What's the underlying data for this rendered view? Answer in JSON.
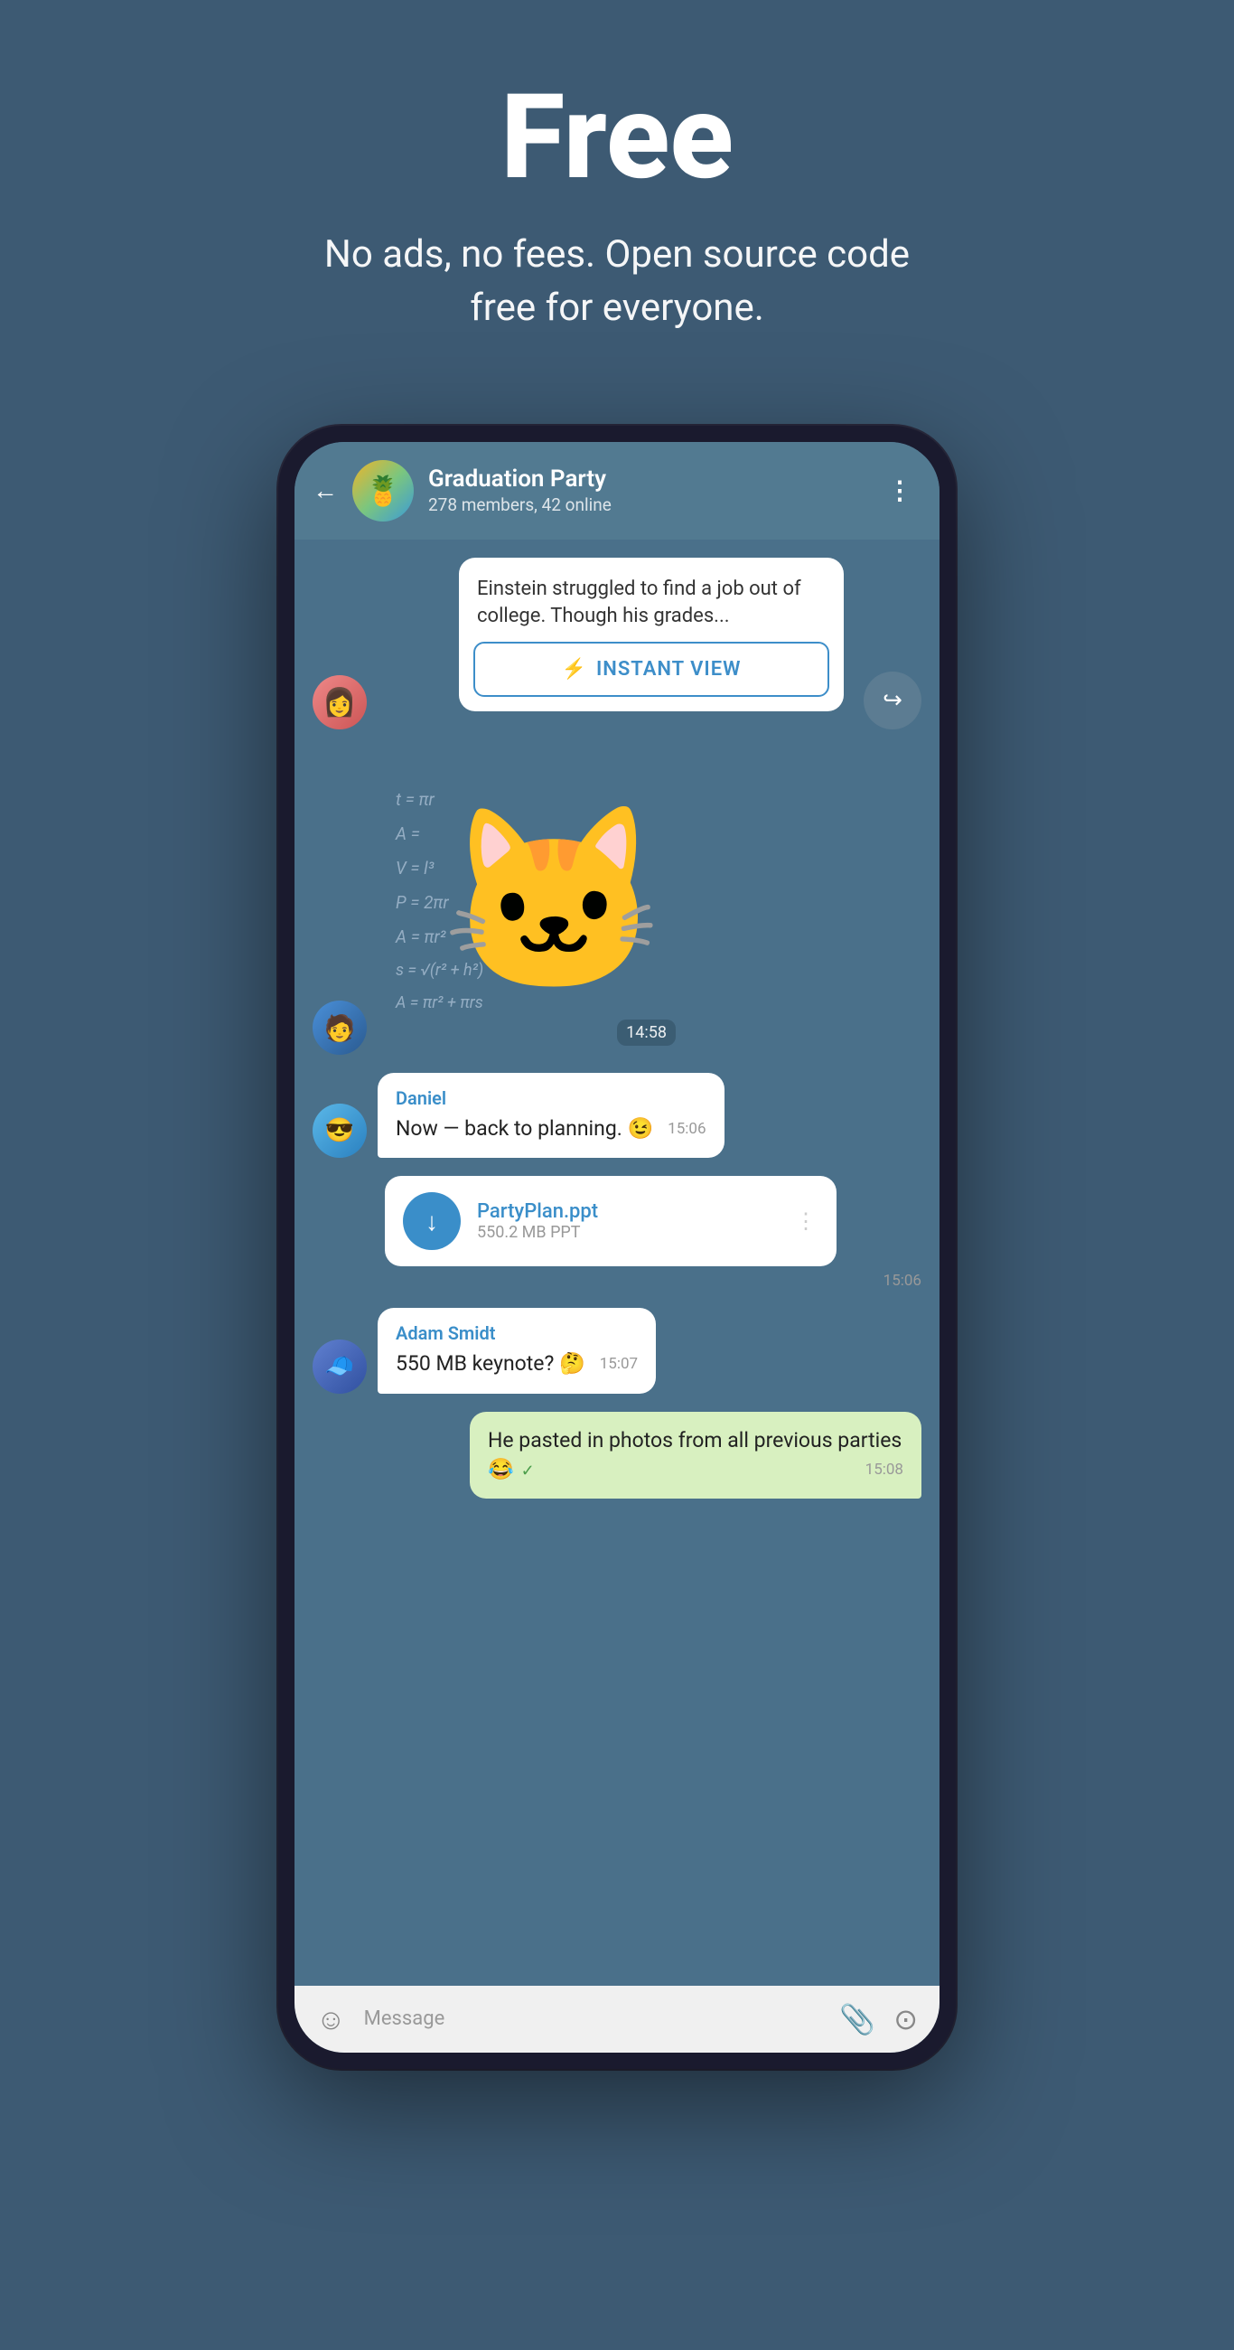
{
  "hero": {
    "title": "Free",
    "subtitle": "No ads, no fees. Open source code free for everyone."
  },
  "chat": {
    "back_label": "←",
    "group_name": "Graduation Party",
    "group_meta": "278 members, 42 online",
    "more_icon": "⋮",
    "article_text": "Einstein struggled to find a job out of college. Though his grades...",
    "instant_view_label": "INSTANT VIEW",
    "sticker_time": "14:58",
    "messages": [
      {
        "sender": "Daniel",
        "sender_color": "#3a8ec9",
        "text": "Now — back to planning. 😉",
        "time": "15:06",
        "type": "received"
      },
      {
        "type": "file",
        "filename": "PartyPlan.ppt",
        "filesize": "550.2 MB PPT",
        "time": "15:06"
      },
      {
        "sender": "Adam Smidt",
        "sender_color": "#3a8ec9",
        "text": "550 MB keynote? 🤔",
        "time": "15:07",
        "type": "received"
      },
      {
        "text": "He pasted in photos from all previous parties 😂",
        "time": "15:08",
        "type": "own",
        "checked": true
      }
    ],
    "input_placeholder": "Message"
  },
  "icons": {
    "bolt": "⚡",
    "share": "↪",
    "download": "↓",
    "emoji": "☺",
    "attach": "📎",
    "camera": "⊙",
    "checkmark": "✓"
  },
  "math_formulas": [
    "t = πr",
    "A =",
    "V = l³",
    "P = 2πr",
    "A = πr²",
    "s = √(r² + h²)",
    "A = πr² + πrs"
  ]
}
